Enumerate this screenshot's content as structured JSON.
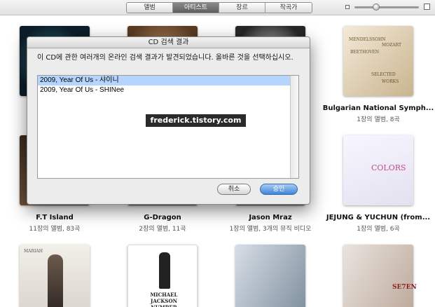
{
  "toolbar": {
    "tabs": [
      {
        "label": "앨범",
        "active": false
      },
      {
        "label": "아티스트",
        "active": true
      },
      {
        "label": "장르",
        "active": false
      },
      {
        "label": "작곡가",
        "active": false
      }
    ],
    "zoom_small_icon": "small-grid-icon",
    "zoom_large_icon": "large-grid-icon"
  },
  "grid": {
    "row1": [
      {
        "name": "",
        "sub": ""
      },
      {
        "name": "",
        "sub": ""
      },
      {
        "name": "",
        "sub": ""
      },
      {
        "name": "Bulgarian National Symph...",
        "sub": "1장의 앨범, 8곡",
        "cover_lines": [
          "MENDELSSOHN",
          "MOZART",
          "BEETHOVEN",
          "SELECTED",
          "WORKS"
        ]
      }
    ],
    "row2": [
      {
        "name": "F.T Island",
        "sub": "11장의 앨범, 83곡"
      },
      {
        "name": "G-Dragon",
        "sub": "2장의 앨범, 11곡"
      },
      {
        "name": "Jason Mraz",
        "sub": "1장의 앨범, 3개의 뮤직 비디오"
      },
      {
        "name": "JEJUNG & YUCHUN (from...",
        "sub": "1장의 앨범, 6곡",
        "cover_text": "COLORS"
      }
    ],
    "row3": [
      {
        "cover_text": "MARIAH"
      },
      {
        "cover_text": "MICHAEL JACKSON NUMBER ONES"
      },
      {
        "cover_text": ""
      },
      {
        "cover_text": "SE7EN"
      }
    ]
  },
  "dialog": {
    "title": "CD 검색 결과",
    "message": "이 CD에 관한 여러개의 온라인 검색 결과가 발견되었습니다. 올바른 것을 선택하십시오.",
    "results": [
      {
        "label": "2009, Year Of Us - 샤이니",
        "selected": true
      },
      {
        "label": "2009, Year Of Us - SHINee",
        "selected": false
      }
    ],
    "cancel_label": "취소",
    "ok_label": "승인"
  },
  "watermark": "frederick.tistory.com",
  "colors": {
    "selection": "#b5d5ff",
    "ok_button": "#3f84d8"
  }
}
